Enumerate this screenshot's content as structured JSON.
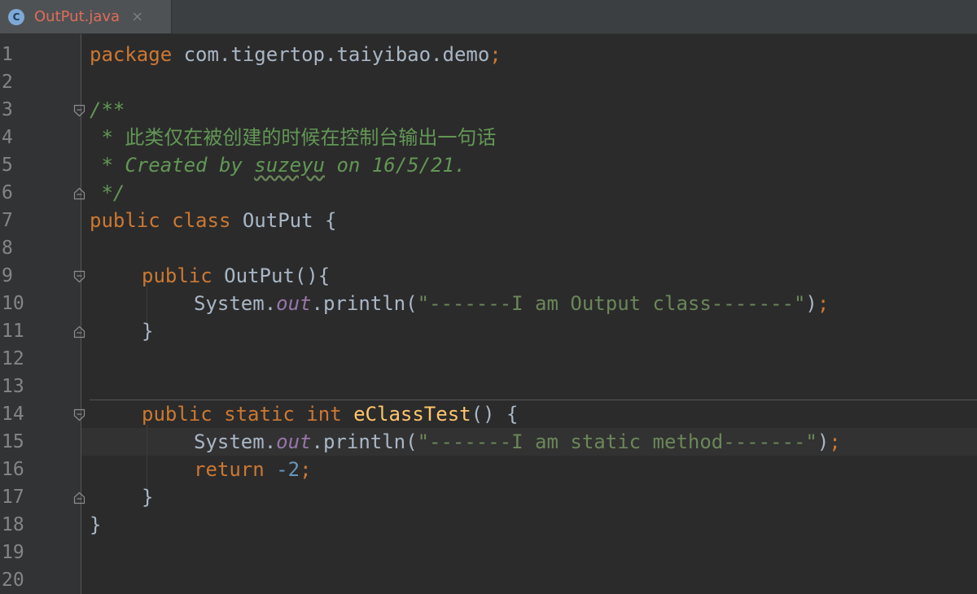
{
  "tab": {
    "icon_letter": "C",
    "filename": "OutPut.java",
    "close_glyph": "×"
  },
  "line_numbers": [
    "1",
    "2",
    "3",
    "4",
    "5",
    "6",
    "7",
    "8",
    "9",
    "10",
    "11",
    "12",
    "13",
    "14",
    "15",
    "16",
    "17",
    "18",
    "19",
    "20"
  ],
  "code": {
    "l1": {
      "kw": "package",
      "rest": " com.tigertop.taiyibao.demo",
      "semi": ";"
    },
    "l3": "/**",
    "l4": " * 此类仅在被创建的时候在控制台输出一句话",
    "l5a": " * Created by ",
    "l5b": "suzeyu",
    "l5c": " on 16/5/21.",
    "l6": " */",
    "l7": {
      "kw": "public class",
      "rest": " OutPut {"
    },
    "l9": {
      "kw": "public",
      "rest": " OutPut(){"
    },
    "l10": {
      "pre": "System.",
      "field": "out",
      "mid": ".println(",
      "str": "\"-------I am Output class-------\"",
      "post": ")",
      "semi": ";"
    },
    "l11": "}",
    "l14": {
      "kw": "public static int",
      "fn": "eClassTest",
      "rest": "() {"
    },
    "l15": {
      "pre": "System.",
      "field": "out",
      "mid": ".println(",
      "str": "\"-------I am static method-------\"",
      "post": ")",
      "semi": ";"
    },
    "l16": {
      "kw": "return",
      "num": "-2",
      "semi": ";"
    },
    "l17": "}",
    "l18": "}"
  },
  "colors": {
    "keyword": "#cc7832",
    "string": "#6a8759",
    "comment": "#629755",
    "field": "#9876aa",
    "function": "#ffc66d",
    "number": "#6897bb",
    "text": "#a9b7c6"
  }
}
